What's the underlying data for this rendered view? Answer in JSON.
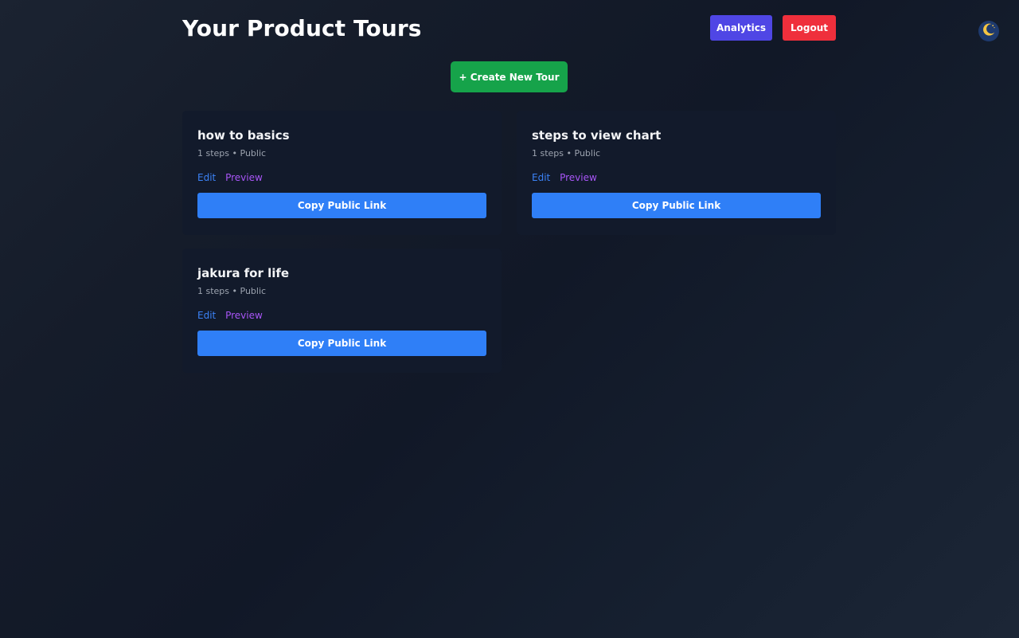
{
  "header": {
    "title": "Your Product Tours",
    "analytics_label": "Analytics",
    "logout_label": "Logout",
    "theme_icon": "moon-icon"
  },
  "actions": {
    "create_label": "+ Create New Tour"
  },
  "tours": [
    {
      "title": "how to basics",
      "meta": "1 steps • Public",
      "edit_label": "Edit",
      "preview_label": "Preview",
      "copy_label": "Copy Public Link"
    },
    {
      "title": "steps to view chart",
      "meta": "1 steps • Public",
      "edit_label": "Edit",
      "preview_label": "Preview",
      "copy_label": "Copy Public Link"
    },
    {
      "title": "jakura for life",
      "meta": "1 steps • Public",
      "edit_label": "Edit",
      "preview_label": "Preview",
      "copy_label": "Copy Public Link"
    }
  ],
  "colors": {
    "analytics": "#4f46e5",
    "logout": "#ef2f3c",
    "create": "#16a34a",
    "copy": "#2f7ff7",
    "edit_link": "#3b82f6",
    "preview_link": "#a855f7"
  }
}
